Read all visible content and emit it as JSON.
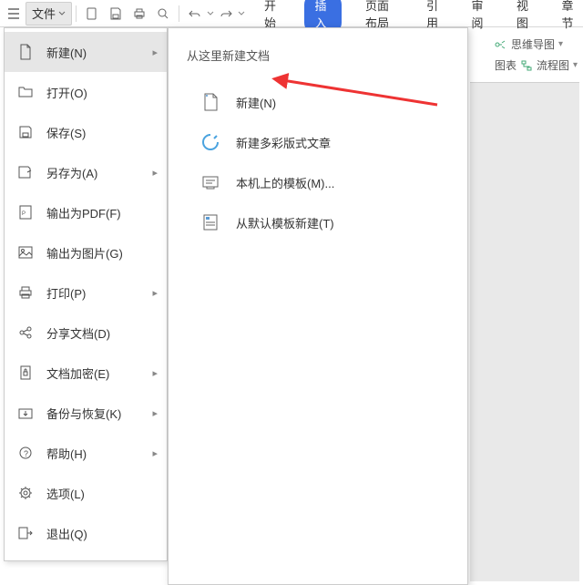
{
  "toolbar": {
    "file_label": "文件"
  },
  "menubar": {
    "tabs": [
      "开始",
      "插入",
      "页面布局",
      "引用",
      "审阅",
      "视图",
      "章节"
    ],
    "active_index": 1
  },
  "right_tools": {
    "mindmap": "思维导图",
    "chart": "图表",
    "flowchart": "流程图"
  },
  "file_menu": {
    "items": [
      {
        "icon": "new-doc-icon",
        "label": "新建(N)",
        "has_sub": true,
        "selected": true
      },
      {
        "icon": "open-icon",
        "label": "打开(O)"
      },
      {
        "icon": "save-icon",
        "label": "保存(S)"
      },
      {
        "icon": "saveas-icon",
        "label": "另存为(A)",
        "has_sub": true
      },
      {
        "icon": "pdf-icon",
        "label": "输出为PDF(F)"
      },
      {
        "icon": "image-icon",
        "label": "输出为图片(G)"
      },
      {
        "icon": "print-icon",
        "label": "打印(P)",
        "has_sub": true
      },
      {
        "icon": "share-icon",
        "label": "分享文档(D)"
      },
      {
        "icon": "encrypt-icon",
        "label": "文档加密(E)",
        "has_sub": true
      },
      {
        "icon": "backup-icon",
        "label": "备份与恢复(K)",
        "has_sub": true
      },
      {
        "icon": "help-icon",
        "label": "帮助(H)",
        "has_sub": true
      },
      {
        "icon": "options-icon",
        "label": "选项(L)"
      },
      {
        "icon": "exit-icon",
        "label": "退出(Q)"
      }
    ]
  },
  "submenu": {
    "title": "从这里新建文档",
    "items": [
      {
        "icon": "blank-doc-icon",
        "label": "新建(N)"
      },
      {
        "icon": "colorful-doc-icon",
        "label": "新建多彩版式文章"
      },
      {
        "icon": "local-template-icon",
        "label": "本机上的模板(M)..."
      },
      {
        "icon": "default-template-icon",
        "label": "从默认模板新建(T)"
      }
    ]
  }
}
